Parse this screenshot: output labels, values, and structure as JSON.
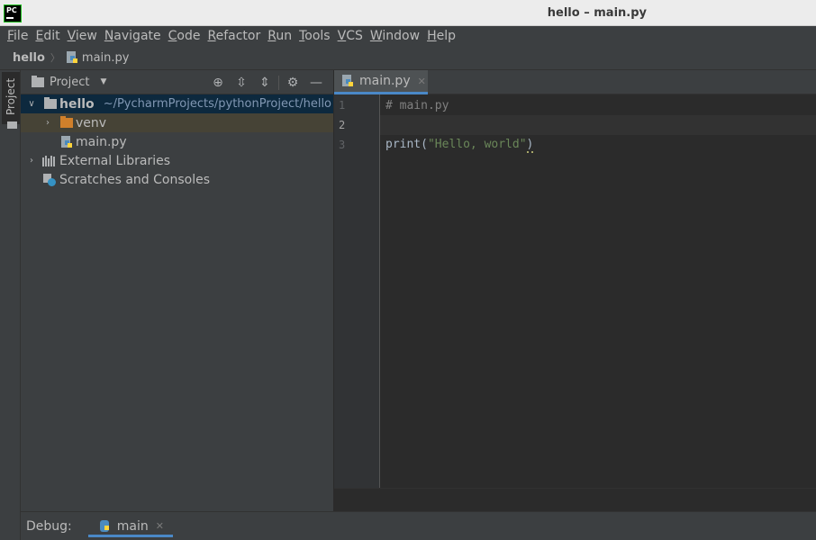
{
  "window": {
    "title": "hello – main.py"
  },
  "menu": [
    {
      "mnemonic": "F",
      "rest": "ile"
    },
    {
      "mnemonic": "E",
      "rest": "dit"
    },
    {
      "mnemonic": "V",
      "rest": "iew"
    },
    {
      "mnemonic": "N",
      "rest": "avigate"
    },
    {
      "mnemonic": "C",
      "rest": "ode"
    },
    {
      "mnemonic": "R",
      "rest": "efactor"
    },
    {
      "mnemonic": "R",
      "rest": "un"
    },
    {
      "mnemonic": "T",
      "rest": "ools"
    },
    {
      "mnemonic": "V",
      "rest": "CS"
    },
    {
      "mnemonic": "W",
      "rest": "indow"
    },
    {
      "mnemonic": "H",
      "rest": "elp"
    }
  ],
  "breadcrumb": {
    "project": "hello",
    "file": "main.py"
  },
  "sidebar": {
    "project_tab": "Project"
  },
  "project_panel": {
    "title": "Project",
    "tree": {
      "root": {
        "label": "hello",
        "path": "~/PycharmProjects/pythonProject/hello"
      },
      "venv": "venv",
      "main": "main.py",
      "external": "External Libraries",
      "scratches": "Scratches and Consoles"
    }
  },
  "editor": {
    "tab": "main.py",
    "lines": [
      "1",
      "2",
      "3"
    ],
    "code": {
      "comment": "# main.py",
      "fn": "print",
      "open": "(",
      "str": "\"Hello, world\"",
      "close": ")"
    }
  },
  "debug": {
    "label": "Debug:",
    "tab": "main"
  },
  "colors": {
    "accent": "#4a88c7",
    "selection": "#0d293e",
    "string": "#6a8759",
    "comment": "#808080"
  }
}
